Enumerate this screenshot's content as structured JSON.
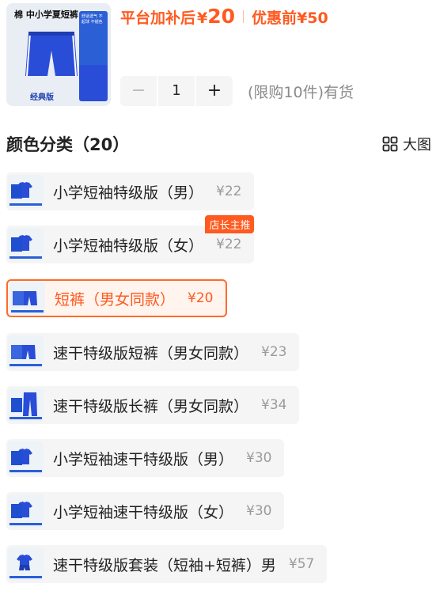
{
  "product": {
    "thumb_title": "棉 中小学夏短裤",
    "thumb_label": "经典版",
    "thumb_side_text": "舒适透气 不起球 不褪色",
    "price_after_label": "平台加补后",
    "price_after_symbol": "¥",
    "price_after_value": "20",
    "price_before_label": "优惠前",
    "price_before_value": "¥50"
  },
  "quantity": {
    "minus": "−",
    "value": "1",
    "plus": "+",
    "limit_text": "(限购10件)有货"
  },
  "section": {
    "title": "颜色分类（20）",
    "view_label": "大图"
  },
  "options": [
    {
      "name": "小学短袖特级版（男）",
      "price": "¥22",
      "badge": "",
      "selected": false,
      "thumb": "shirt"
    },
    {
      "name": "小学短袖特级版（女）",
      "price": "¥22",
      "badge": "店长主推",
      "selected": false,
      "thumb": "shirt"
    },
    {
      "name": "短裤（男女同款）",
      "price": "¥20",
      "badge": "",
      "selected": true,
      "thumb": "shorts"
    },
    {
      "name": "速干特级版短裤（男女同款）",
      "price": "¥23",
      "badge": "",
      "selected": false,
      "thumb": "shorts"
    },
    {
      "name": "速干特级版长裤（男女同款）",
      "price": "¥34",
      "badge": "",
      "selected": false,
      "thumb": "pants"
    },
    {
      "name": "小学短袖速干特级版（男）",
      "price": "¥30",
      "badge": "",
      "selected": false,
      "thumb": "shirt"
    },
    {
      "name": "小学短袖速干特级版（女）",
      "price": "¥30",
      "badge": "",
      "selected": false,
      "thumb": "shirt"
    },
    {
      "name": "速干特级版套装（短袖+短裤）男",
      "price": "¥57",
      "badge": "",
      "selected": false,
      "thumb": "set"
    }
  ],
  "colors": {
    "accent": "#ff5a1f",
    "uniform_blue": "#2a4dd8"
  }
}
